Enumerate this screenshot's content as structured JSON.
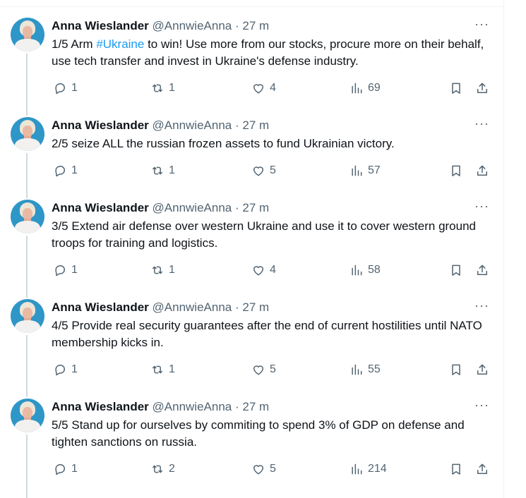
{
  "tweets": [
    {
      "name": "Anna Wieslander",
      "handle": "@AnnwieAnna",
      "dot": "·",
      "time": "27 m",
      "more": "···",
      "text_before": "1/5 Arm ",
      "hashtag": "#Ukraine",
      "text_after": " to win! Use more from our stocks, procure more on their behalf, use tech transfer and invest in Ukraine's defense industry.",
      "replies": "1",
      "retweets": "1",
      "likes": "4",
      "views": "69"
    },
    {
      "name": "Anna Wieslander",
      "handle": "@AnnwieAnna",
      "dot": "·",
      "time": "27 m",
      "more": "···",
      "text_before": "2/5 seize ALL the russian frozen assets to fund Ukrainian victory.",
      "hashtag": "",
      "text_after": "",
      "replies": "1",
      "retweets": "1",
      "likes": "5",
      "views": "57"
    },
    {
      "name": "Anna Wieslander",
      "handle": "@AnnwieAnna",
      "dot": "·",
      "time": "27 m",
      "more": "···",
      "text_before": "3/5 Extend air defense over western Ukraine and use it to cover western ground troops for training and logistics.",
      "hashtag": "",
      "text_after": "",
      "replies": "1",
      "retweets": "1",
      "likes": "4",
      "views": "58"
    },
    {
      "name": "Anna Wieslander",
      "handle": "@AnnwieAnna",
      "dot": "·",
      "time": "27 m",
      "more": "···",
      "text_before": "4/5 Provide real security guarantees after the end of current hostilities until NATO membership kicks in.",
      "hashtag": "",
      "text_after": "",
      "replies": "1",
      "retweets": "1",
      "likes": "5",
      "views": "55"
    },
    {
      "name": "Anna Wieslander",
      "handle": "@AnnwieAnna",
      "dot": "·",
      "time": "27 m",
      "more": "···",
      "text_before": "5/5 Stand up for ourselves by commiting to spend 3% of GDP on defense and tighten sanctions on russia.",
      "hashtag": "",
      "text_after": "",
      "replies": "1",
      "retweets": "2",
      "likes": "5",
      "views": "214"
    }
  ],
  "icons": {
    "reply": "reply-icon",
    "retweet": "retweet-icon",
    "like": "heart-icon",
    "views": "views-icon",
    "bookmark": "bookmark-icon",
    "share": "share-icon",
    "more": "more-icon"
  },
  "colors": {
    "hashtag": "#1d9bf0",
    "secondary_text": "#536471",
    "thread_line": "#cfd9de"
  }
}
